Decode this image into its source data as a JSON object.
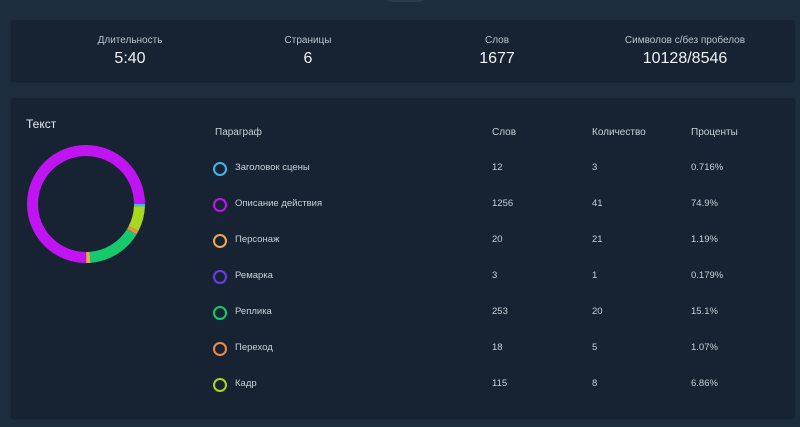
{
  "stats": [
    {
      "label": "Длительность",
      "value": "5:40"
    },
    {
      "label": "Страницы",
      "value": "6"
    },
    {
      "label": "Слов",
      "value": "1677"
    },
    {
      "label": "Символов с/без пробелов",
      "value": "10128/8546"
    }
  ],
  "text_section": {
    "title": "Текст",
    "headers": {
      "paragraph": "Параграф",
      "words": "Слов",
      "count": "Количество",
      "percent": "Проценты"
    },
    "rows": [
      {
        "name": "Заголовок сцены",
        "words": "12",
        "count": "3",
        "percent": "0.716%",
        "color": "#3fb7ea",
        "pct": 0.716
      },
      {
        "name": "Описание действия",
        "words": "1256",
        "count": "41",
        "percent": "74.9%",
        "color": "#c014f2",
        "pct": 74.9
      },
      {
        "name": "Персонаж",
        "words": "20",
        "count": "21",
        "percent": "1.19%",
        "color": "#f2a74e",
        "pct": 1.19
      },
      {
        "name": "Ремарка",
        "words": "3",
        "count": "1",
        "percent": "0.179%",
        "color": "#6a3cf0",
        "pct": 0.179
      },
      {
        "name": "Реплика",
        "words": "253",
        "count": "20",
        "percent": "15.1%",
        "color": "#16c96b",
        "pct": 15.1
      },
      {
        "name": "Переход",
        "words": "18",
        "count": "5",
        "percent": "1.07%",
        "color": "#f08a45",
        "pct": 1.07
      },
      {
        "name": "Кадр",
        "words": "115",
        "count": "8",
        "percent": "6.86%",
        "color": "#a8d820",
        "pct": 6.86
      }
    ]
  }
}
